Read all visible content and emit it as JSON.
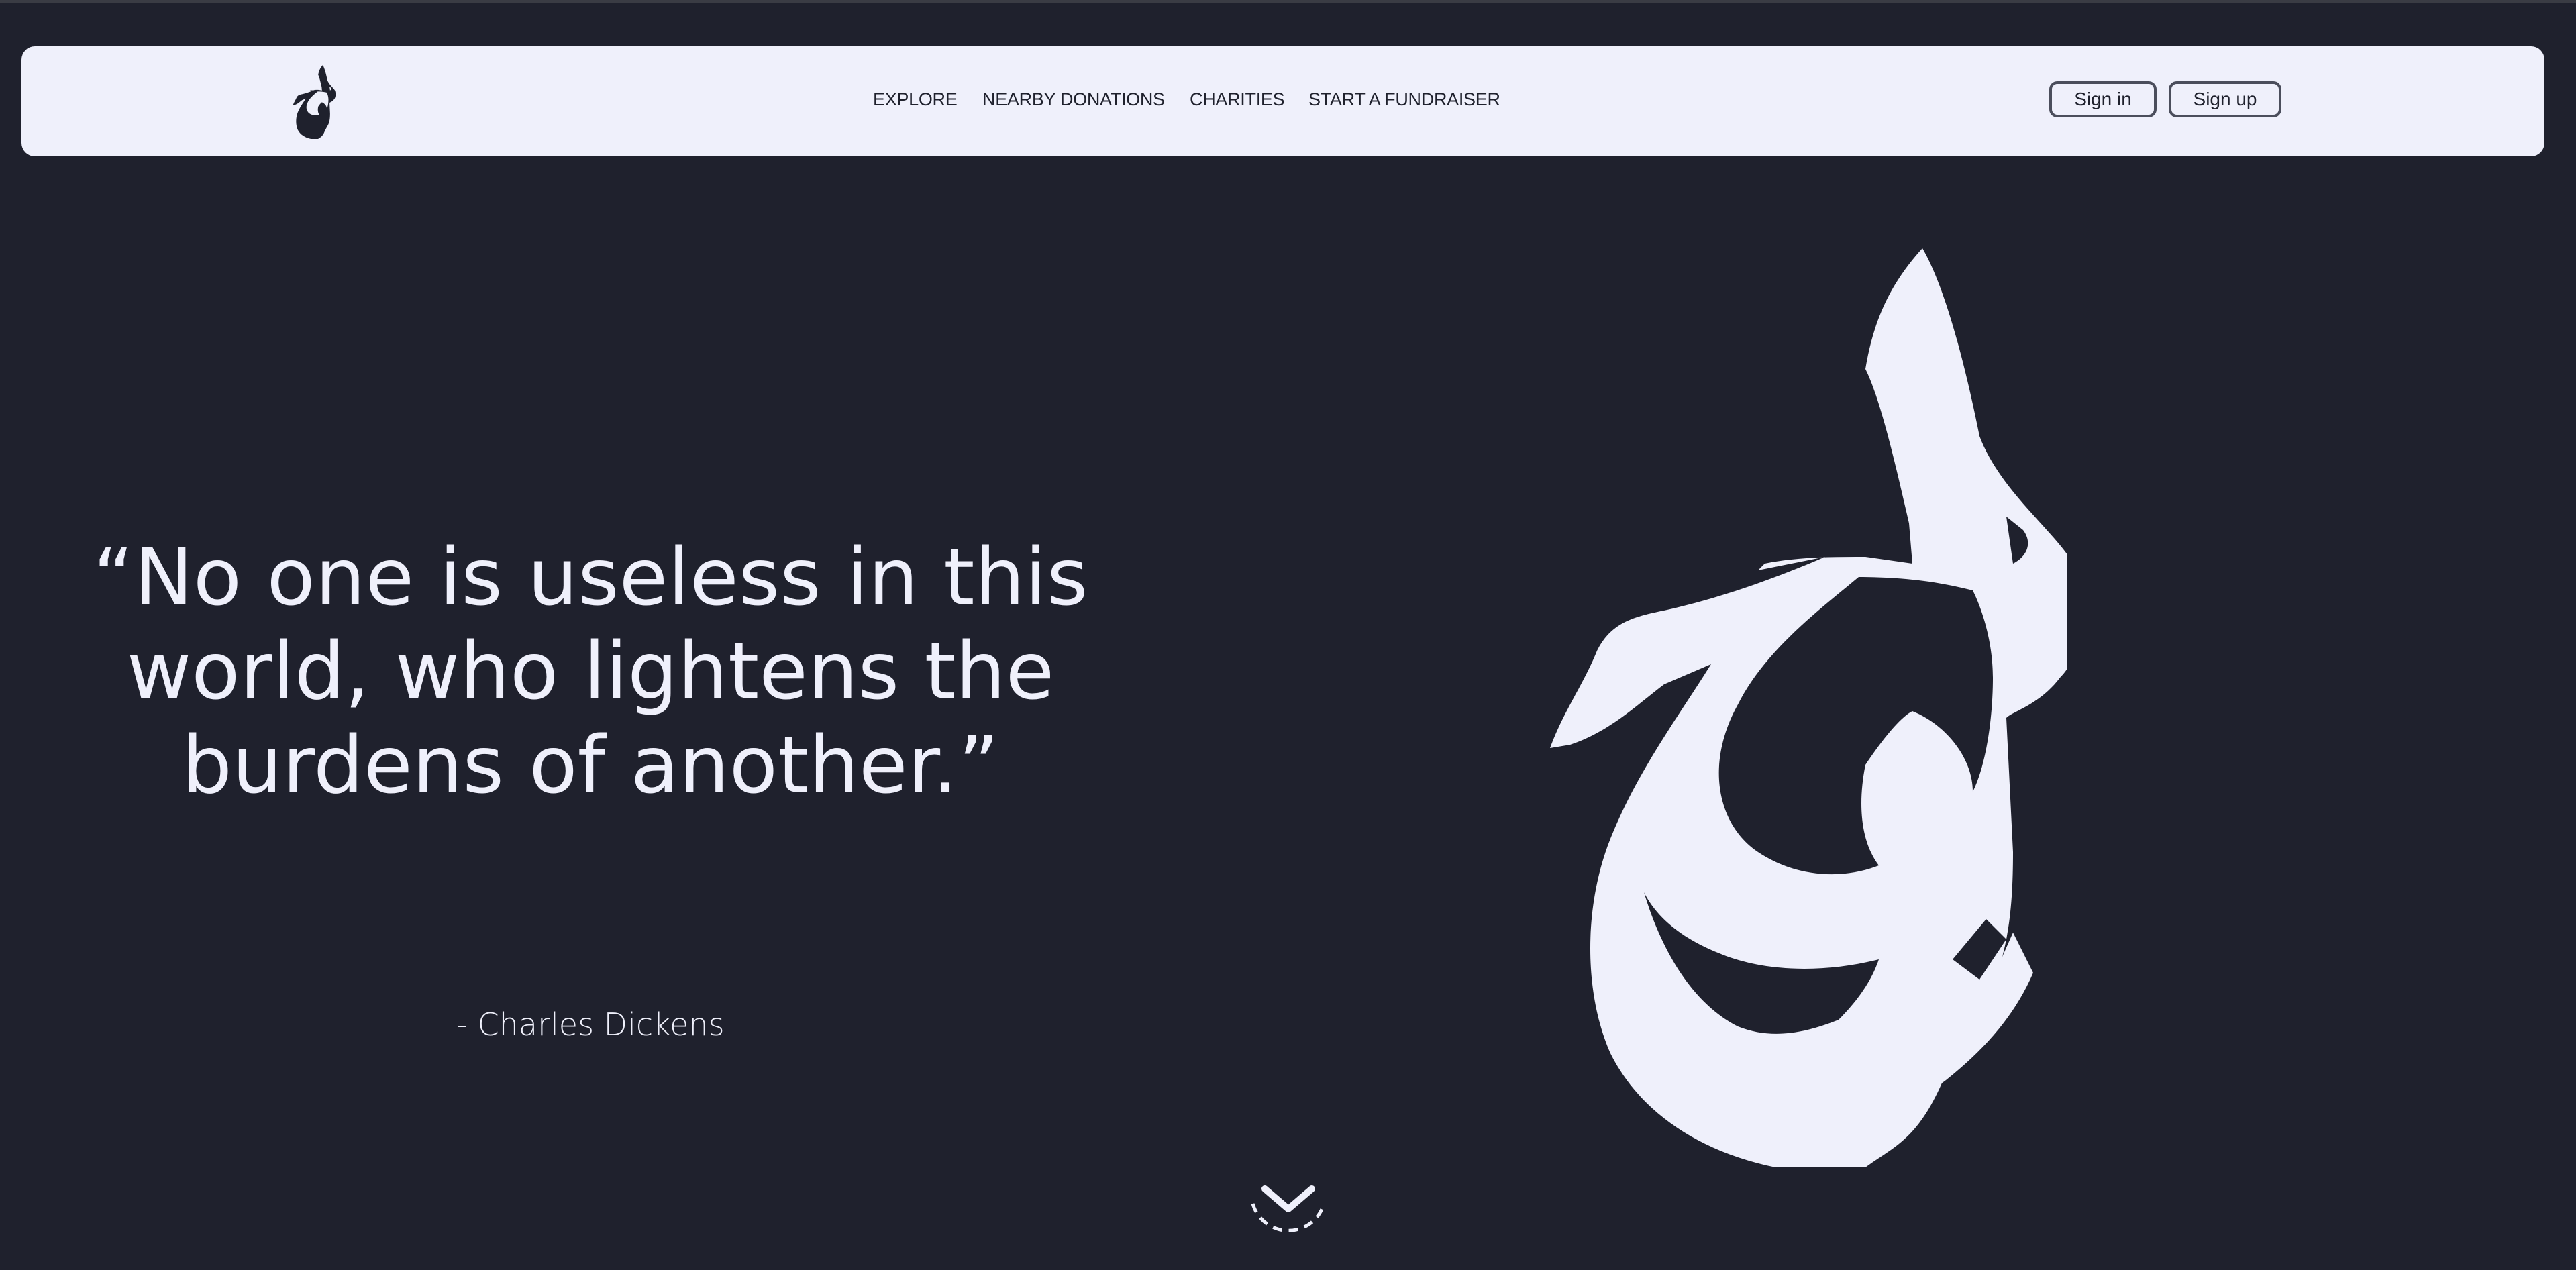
{
  "nav": {
    "logo_icon": "calligraphy-logo-icon",
    "links": [
      {
        "label": "EXPLORE"
      },
      {
        "label": "NEARBY DONATIONS"
      },
      {
        "label": "CHARITIES"
      },
      {
        "label": "START A FUNDRAISER"
      }
    ],
    "sign_in_label": "Sign in",
    "sign_up_label": "Sign up"
  },
  "hero": {
    "quote": "“No one is useless in this world, who lightens the burdens of another.”",
    "author": "- Charles Dickens",
    "logo_icon": "calligraphy-logo-icon",
    "scroll_icon": "chevron-down-icon"
  },
  "colors": {
    "background": "#1f212d",
    "navbar": "#eff0fb",
    "text_light": "#eff0fb",
    "text_dark": "#1f212d",
    "button_border": "#4b4e5c"
  }
}
